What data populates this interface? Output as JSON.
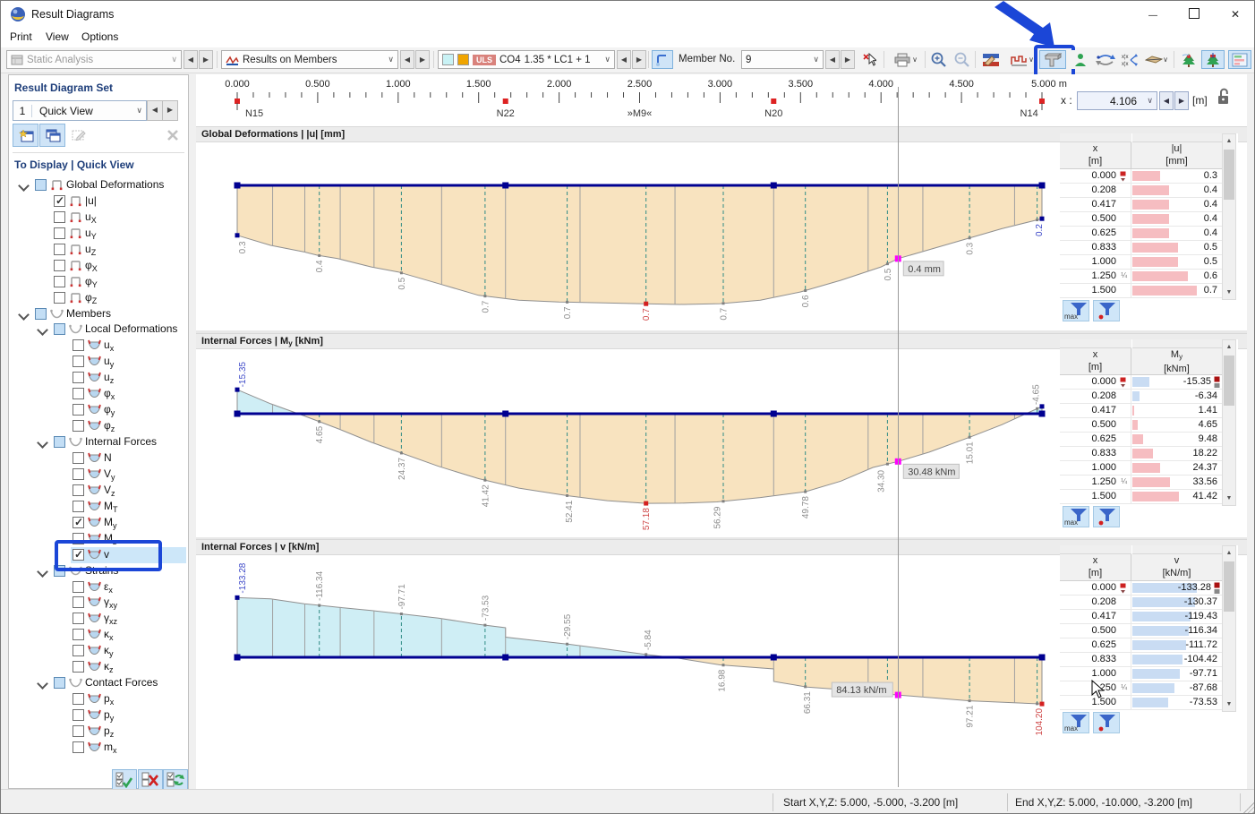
{
  "window": {
    "title": "Result Diagrams"
  },
  "menu": {
    "items": [
      "Print",
      "View",
      "Options"
    ]
  },
  "toolbar": {
    "analysis_combo": "Static Analysis",
    "results_combo": "Results on Members",
    "design_badge": "ULS",
    "combo_case": "CO4",
    "combo_expr": "1.35 * LC1 + 1...",
    "member_label": "Member No.",
    "member_value": "9"
  },
  "sidebar": {
    "set_title": "Result Diagram Set",
    "set_number": "1",
    "set_name": "Quick View",
    "tree_title": "To Display | Quick View",
    "tree": [
      {
        "k": "group",
        "lvl": 0,
        "icon": "frame",
        "chk": "part",
        "base": "Global Deformations",
        "sub": ""
      },
      {
        "k": "item",
        "lvl": 1,
        "icon": "frame",
        "chk": "on",
        "base": "|u|",
        "sub": ""
      },
      {
        "k": "item",
        "lvl": 1,
        "icon": "frame",
        "chk": "off",
        "base": "u",
        "sub": "X"
      },
      {
        "k": "item",
        "lvl": 1,
        "icon": "frame",
        "chk": "off",
        "base": "u",
        "sub": "Y"
      },
      {
        "k": "item",
        "lvl": 1,
        "icon": "frame",
        "chk": "off",
        "base": "u",
        "sub": "Z"
      },
      {
        "k": "item",
        "lvl": 1,
        "icon": "frame",
        "chk": "off",
        "base": "φ",
        "sub": "X"
      },
      {
        "k": "item",
        "lvl": 1,
        "icon": "frame",
        "chk": "off",
        "base": "φ",
        "sub": "Y"
      },
      {
        "k": "item",
        "lvl": 1,
        "icon": "frame",
        "chk": "off",
        "base": "φ",
        "sub": "Z"
      },
      {
        "k": "group",
        "lvl": 0,
        "icon": "curveG",
        "chk": "part",
        "base": "Members",
        "sub": ""
      },
      {
        "k": "group",
        "lvl": 1,
        "icon": "curveG",
        "chk": "part",
        "base": "Local Deformations",
        "sub": ""
      },
      {
        "k": "item",
        "lvl": 2,
        "icon": "curveI",
        "chk": "off",
        "base": "u",
        "sub": "x"
      },
      {
        "k": "item",
        "lvl": 2,
        "icon": "curveI",
        "chk": "off",
        "base": "u",
        "sub": "y"
      },
      {
        "k": "item",
        "lvl": 2,
        "icon": "curveI",
        "chk": "off",
        "base": "u",
        "sub": "z"
      },
      {
        "k": "item",
        "lvl": 2,
        "icon": "curveI",
        "chk": "off",
        "base": "φ",
        "sub": "x"
      },
      {
        "k": "item",
        "lvl": 2,
        "icon": "curveI",
        "chk": "off",
        "base": "φ",
        "sub": "y"
      },
      {
        "k": "item",
        "lvl": 2,
        "icon": "curveI",
        "chk": "off",
        "base": "φ",
        "sub": "z"
      },
      {
        "k": "group",
        "lvl": 1,
        "icon": "curveG",
        "chk": "part",
        "base": "Internal Forces",
        "sub": ""
      },
      {
        "k": "item",
        "lvl": 2,
        "icon": "curveI",
        "chk": "off",
        "base": "N",
        "sub": ""
      },
      {
        "k": "item",
        "lvl": 2,
        "icon": "curveI",
        "chk": "off",
        "base": "V",
        "sub": "y"
      },
      {
        "k": "item",
        "lvl": 2,
        "icon": "curveI",
        "chk": "off",
        "base": "V",
        "sub": "z"
      },
      {
        "k": "item",
        "lvl": 2,
        "icon": "curveI",
        "chk": "off",
        "base": "M",
        "sub": "T"
      },
      {
        "k": "item",
        "lvl": 2,
        "icon": "curveI",
        "chk": "on",
        "base": "M",
        "sub": "y"
      },
      {
        "k": "item",
        "lvl": 2,
        "icon": "curveI",
        "chk": "off",
        "base": "M",
        "sub": "z"
      },
      {
        "k": "item",
        "lvl": 2,
        "icon": "curveI",
        "chk": "on",
        "base": "v",
        "sub": "",
        "selected": true
      },
      {
        "k": "group",
        "lvl": 1,
        "icon": "curveG",
        "chk": "part",
        "base": "Strains",
        "sub": ""
      },
      {
        "k": "item",
        "lvl": 2,
        "icon": "curveI",
        "chk": "off",
        "base": "ε",
        "sub": "x"
      },
      {
        "k": "item",
        "lvl": 2,
        "icon": "curveI",
        "chk": "off",
        "base": "γ",
        "sub": "xy"
      },
      {
        "k": "item",
        "lvl": 2,
        "icon": "curveI",
        "chk": "off",
        "base": "γ",
        "sub": "xz"
      },
      {
        "k": "item",
        "lvl": 2,
        "icon": "curveI",
        "chk": "off",
        "base": "κ",
        "sub": "x"
      },
      {
        "k": "item",
        "lvl": 2,
        "icon": "curveI",
        "chk": "off",
        "base": "κ",
        "sub": "y"
      },
      {
        "k": "item",
        "lvl": 2,
        "icon": "curveI",
        "chk": "off",
        "base": "κ",
        "sub": "z"
      },
      {
        "k": "group",
        "lvl": 1,
        "icon": "curveG",
        "chk": "part",
        "base": "Contact Forces",
        "sub": ""
      },
      {
        "k": "item",
        "lvl": 2,
        "icon": "curveI",
        "chk": "off",
        "base": "p",
        "sub": "x"
      },
      {
        "k": "item",
        "lvl": 2,
        "icon": "curveI",
        "chk": "off",
        "base": "p",
        "sub": "y"
      },
      {
        "k": "item",
        "lvl": 2,
        "icon": "curveI",
        "chk": "off",
        "base": "p",
        "sub": "z"
      },
      {
        "k": "item",
        "lvl": 2,
        "icon": "curveI",
        "chk": "off",
        "base": "m",
        "sub": "x"
      }
    ]
  },
  "ruler": {
    "tick_labels": [
      "0.000",
      "0.500",
      "1.000",
      "1.500",
      "2.000",
      "2.500",
      "3.000",
      "3.500",
      "4.000",
      "4.500",
      "5.000 m"
    ],
    "squares_x": [
      0,
      1.667,
      3.333,
      5.0
    ],
    "node_labels": [
      {
        "t": "N15",
        "x": 0.05,
        "a": "start"
      },
      {
        "t": "N22",
        "x": 1.667,
        "a": "middle"
      },
      {
        "t": "»M9«",
        "x": 2.5,
        "a": "middle"
      },
      {
        "t": "N20",
        "x": 3.333,
        "a": "middle"
      },
      {
        "t": "N14",
        "x": 4.92,
        "a": "middle"
      }
    ],
    "x_label": "x :",
    "x_value": "4.106",
    "unit": "[m]",
    "length_m": 5.0
  },
  "cursor_x": 4.106,
  "chart_data": [
    {
      "type": "area",
      "title_parts": [
        {
          "t": "Global Deformations | |u| [mm]"
        }
      ],
      "quantity": "|u|",
      "unit": "mm",
      "x_unit": "m",
      "x_range": [
        0,
        5
      ],
      "points": [
        [
          0,
          0.3
        ],
        [
          0.208,
          0.36
        ],
        [
          0.417,
          0.4
        ],
        [
          0.5,
          0.42
        ],
        [
          0.625,
          0.44
        ],
        [
          0.833,
          0.49
        ],
        [
          1.0,
          0.52
        ],
        [
          1.25,
          0.59
        ],
        [
          1.5,
          0.66
        ],
        [
          1.75,
          0.69
        ],
        [
          2.0,
          0.7
        ],
        [
          2.25,
          0.705
        ],
        [
          2.5,
          0.71
        ],
        [
          2.75,
          0.715
        ],
        [
          3.0,
          0.71
        ],
        [
          3.25,
          0.69
        ],
        [
          3.5,
          0.64
        ],
        [
          3.75,
          0.57
        ],
        [
          4.0,
          0.49
        ],
        [
          4.106,
          0.44
        ],
        [
          4.25,
          0.4
        ],
        [
          4.5,
          0.33
        ],
        [
          4.75,
          0.26
        ],
        [
          5.0,
          0.2
        ]
      ],
      "labels": [
        {
          "x": 0.03,
          "t": "0.3"
        },
        {
          "x": 0.51,
          "t": "0.4"
        },
        {
          "x": 1.02,
          "t": "0.5"
        },
        {
          "x": 1.54,
          "t": "0.7"
        },
        {
          "x": 2.05,
          "t": "0.7"
        },
        {
          "x": 2.54,
          "t": "0.7",
          "c": "red"
        },
        {
          "x": 3.02,
          "t": "0.7"
        },
        {
          "x": 3.53,
          "t": "0.6"
        },
        {
          "x": 4.04,
          "t": "0.5"
        },
        {
          "x": 4.55,
          "t": "0.3"
        },
        {
          "x": 4.98,
          "t": "0.2",
          "c": "blue"
        }
      ],
      "markers": [
        {
          "x": 0,
          "c": "navy"
        },
        {
          "x": 5,
          "c": "navy"
        },
        {
          "x": 2.54,
          "c": "red"
        }
      ],
      "tooltip": {
        "text": "0.4 mm",
        "side": "right"
      }
    },
    {
      "type": "area",
      "title_parts": [
        {
          "t": "Internal Forces | M"
        },
        {
          "s": "y"
        },
        {
          "t": " [kNm]"
        }
      ],
      "quantity": "My",
      "unit": "kNm",
      "x_unit": "m",
      "x_range": [
        0,
        5
      ],
      "points": [
        [
          0,
          -15.35
        ],
        [
          0.208,
          -6.34
        ],
        [
          0.417,
          1.41
        ],
        [
          0.5,
          4.65
        ],
        [
          0.625,
          9.48
        ],
        [
          0.833,
          18.22
        ],
        [
          1.0,
          24.37
        ],
        [
          1.25,
          33.56
        ],
        [
          1.5,
          41.42
        ],
        [
          1.75,
          47.5
        ],
        [
          2.06,
          52.41
        ],
        [
          2.3,
          55.5
        ],
        [
          2.54,
          57.18
        ],
        [
          2.75,
          57.1
        ],
        [
          2.98,
          56.29
        ],
        [
          3.25,
          53.5
        ],
        [
          3.53,
          49.78
        ],
        [
          3.75,
          43.0
        ],
        [
          3.95,
          34.3
        ],
        [
          4.106,
          30.48
        ],
        [
          4.3,
          24.5
        ],
        [
          4.55,
          15.01
        ],
        [
          4.75,
          7.0
        ],
        [
          5.0,
          -4.65
        ]
      ],
      "labels": [
        {
          "x": 0.03,
          "t": "-15.35",
          "c": "blue"
        },
        {
          "x": 0.51,
          "t": "4.65"
        },
        {
          "x": 1.02,
          "t": "24.37"
        },
        {
          "x": 1.54,
          "t": "41.42"
        },
        {
          "x": 2.06,
          "t": "52.41"
        },
        {
          "x": 2.54,
          "t": "57.18",
          "c": "red"
        },
        {
          "x": 2.98,
          "t": "56.29"
        },
        {
          "x": 3.53,
          "t": "49.78"
        },
        {
          "x": 4.0,
          "t": "34.30"
        },
        {
          "x": 4.55,
          "t": "15.01"
        },
        {
          "x": 4.96,
          "t": "-4.65"
        }
      ],
      "markers": [
        {
          "x": 0,
          "c": "navy"
        },
        {
          "x": 5,
          "c": "navy"
        },
        {
          "x": 2.54,
          "c": "red"
        }
      ],
      "tooltip": {
        "text": "30.48 kNm",
        "side": "right"
      }
    },
    {
      "type": "area",
      "title_parts": [
        {
          "t": "Internal Forces | v [kN/m]"
        }
      ],
      "quantity": "v",
      "unit": "kN/m",
      "x_unit": "m",
      "x_range": [
        0,
        5
      ],
      "points": [
        [
          0,
          -133.28
        ],
        [
          0.208,
          -130.37
        ],
        [
          0.417,
          -119.43
        ],
        [
          0.5,
          -116.34
        ],
        [
          0.625,
          -111.72
        ],
        [
          0.833,
          -104.42
        ],
        [
          1.0,
          -97.71
        ],
        [
          1.25,
          -87.68
        ],
        [
          1.5,
          -73.53
        ],
        [
          1.667,
          -66.0
        ],
        [
          1.667,
          -45.0
        ],
        [
          1.85,
          -37.5
        ],
        [
          2.05,
          -29.55
        ],
        [
          2.3,
          -18.0
        ],
        [
          2.55,
          -5.84
        ],
        [
          2.75,
          2.5
        ],
        [
          3.0,
          16.98
        ],
        [
          3.333,
          26.0
        ],
        [
          3.333,
          54.0
        ],
        [
          3.54,
          66.31
        ],
        [
          3.75,
          72.0
        ],
        [
          4.106,
          84.13
        ],
        [
          4.55,
          97.21
        ],
        [
          5.0,
          104.2
        ]
      ],
      "labels": [
        {
          "x": 0.03,
          "t": "-133.28",
          "c": "blue"
        },
        {
          "x": 0.51,
          "t": "-116.34"
        },
        {
          "x": 1.02,
          "t": "-97.71"
        },
        {
          "x": 1.54,
          "t": "-73.53"
        },
        {
          "x": 2.05,
          "t": "-29.55"
        },
        {
          "x": 2.55,
          "t": "-5.84"
        },
        {
          "x": 3.01,
          "t": "16.98"
        },
        {
          "x": 3.54,
          "t": "66.31"
        },
        {
          "x": 4.55,
          "t": "97.21"
        },
        {
          "x": 4.98,
          "t": "104.20",
          "c": "red"
        }
      ],
      "markers": [
        {
          "x": 0,
          "c": "navy"
        },
        {
          "x": 5,
          "c": "red"
        }
      ],
      "tooltip": {
        "text": "84.13 kN/m",
        "side": "left"
      }
    }
  ],
  "sections": {
    "solid": [
      0.22,
      0.42,
      0.64,
      0.85,
      1.27,
      1.667,
      2.13,
      2.72,
      3.333,
      3.92,
      4.26,
      4.83
    ],
    "dashed": [
      0.51,
      1.02,
      1.54,
      2.05,
      2.54,
      3.02,
      3.53,
      4.04,
      4.55,
      4.97
    ],
    "nodes_x": [
      0,
      1.667,
      3.333,
      5.0
    ]
  },
  "tables": [
    {
      "col1": {
        "main": "x",
        "sub": "",
        "unit": "[m]"
      },
      "col2": {
        "main": "|u|",
        "sub": "",
        "unit": "[mm]"
      },
      "x": [
        "0.000",
        "0.208",
        "0.417",
        "0.500",
        "0.625",
        "0.833",
        "1.000",
        "1.250",
        "1.500"
      ],
      "values": [
        "0.3",
        "0.4",
        "0.4",
        "0.4",
        "0.4",
        "0.5",
        "0.5",
        "0.6",
        "0.7"
      ],
      "vmax": 0.7,
      "frac_row": 7,
      "frac": "¼",
      "x_marker_row": 0,
      "value_markers": false,
      "filter_max_label": "max"
    },
    {
      "col1": {
        "main": "x",
        "sub": "",
        "unit": "[m]"
      },
      "col2": {
        "main": "M",
        "sub": "y",
        "unit": "[kNm]"
      },
      "x": [
        "0.000",
        "0.208",
        "0.417",
        "0.500",
        "0.625",
        "0.833",
        "1.000",
        "1.250",
        "1.500"
      ],
      "values": [
        "-15.35",
        "-6.34",
        "1.41",
        "4.65",
        "9.48",
        "18.22",
        "24.37",
        "33.56",
        "41.42"
      ],
      "vmax": 57.18,
      "frac_row": 7,
      "frac": "¼",
      "x_marker_row": 0,
      "value_markers": true,
      "filter_max_label": "max"
    },
    {
      "col1": {
        "main": "x",
        "sub": "",
        "unit": "[m]"
      },
      "col2": {
        "main": "v",
        "sub": "",
        "unit": "[kN/m]"
      },
      "x": [
        "0.000",
        "0.208",
        "0.417",
        "0.500",
        "0.625",
        "0.833",
        "1.000",
        "1.250",
        "1.500"
      ],
      "values": [
        "-133.28",
        "-130.37",
        "-119.43",
        "-116.34",
        "-111.72",
        "-104.42",
        "-97.71",
        "-87.68",
        "-73.53"
      ],
      "vmax": 133.28,
      "frac_row": 7,
      "frac": "¼",
      "x_marker_row": 0,
      "value_markers": true,
      "filter_max_label": "max"
    }
  ],
  "status": {
    "start": "Start X,Y,Z: 5.000, -5.000, -3.200 [m]",
    "end": "End X,Y,Z: 5.000, -10.000, -3.200 [m]"
  },
  "colors": {
    "fill_positive": "#f8e3bf",
    "fill_negative": "#cfeef5",
    "baseline": "#000091",
    "section_dashed": "#2e8b85",
    "label_gray": "#8d8d8d",
    "label_red": "#cf4848",
    "label_blue": "#3c48c8",
    "bar_positive": "#f6bdc1",
    "bar_negative": "#c9dcf3",
    "annotation_blue": "#1b46d7",
    "cursor_marker": "#ff00ff"
  }
}
